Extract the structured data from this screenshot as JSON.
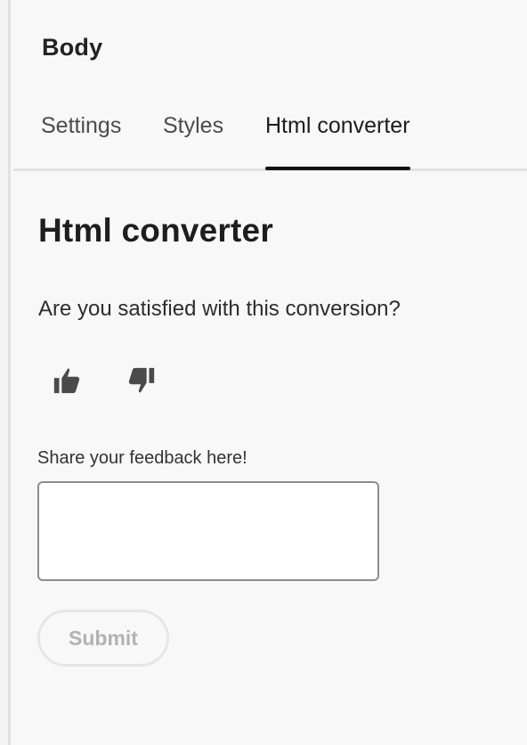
{
  "panel": {
    "title": "Body"
  },
  "tabs": [
    {
      "label": "Settings",
      "selected": false
    },
    {
      "label": "Styles",
      "selected": false
    },
    {
      "label": "Html converter",
      "selected": true
    }
  ],
  "converter": {
    "heading": "Html converter",
    "question": "Are you satisfied with this conversion?",
    "thumbs_up_icon": "thumbs-up-icon",
    "thumbs_down_icon": "thumbs-down-icon",
    "feedback_label": "Share your feedback here!",
    "feedback_value": "",
    "submit_label": "Submit",
    "submit_disabled": true
  },
  "colors": {
    "background": "#f8f8f8",
    "text": "#2c2c2c",
    "tab_indicator": "#111111",
    "divider": "#e1e1e1",
    "disabled_text": "#b2b2b2"
  }
}
